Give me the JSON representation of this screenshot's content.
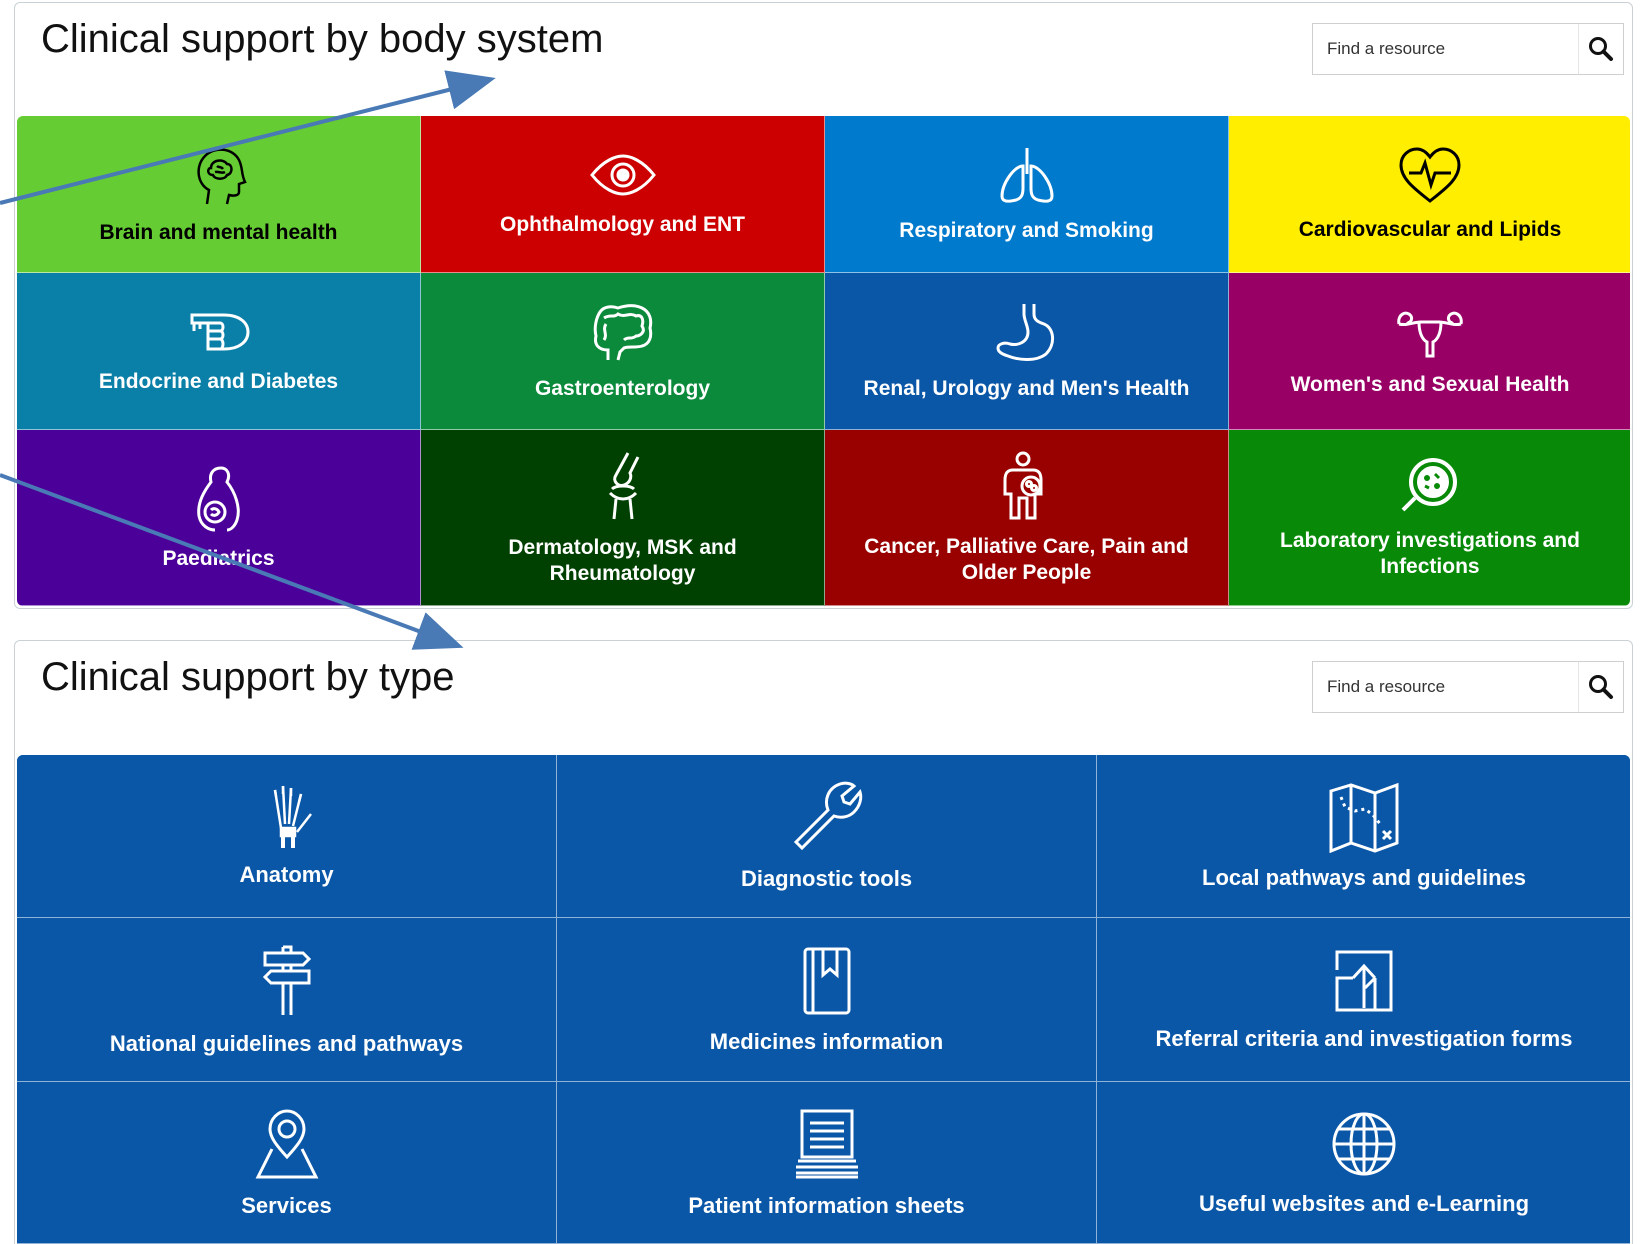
{
  "body_system": {
    "title": "Clinical support by body system",
    "search_placeholder": "Find a resource",
    "tiles": [
      {
        "label": "Brain and mental health",
        "icon": "head-brain-icon",
        "color": "#66cc33",
        "text_color": "#000000"
      },
      {
        "label": "Ophthalmology and ENT",
        "icon": "eye-icon",
        "color": "#cc0000",
        "text_color": "#ffffff"
      },
      {
        "label": "Respiratory and Smoking",
        "icon": "lungs-icon",
        "color": "#007acc",
        "text_color": "#ffffff"
      },
      {
        "label": "Cardiovascular and Lipids",
        "icon": "heart-pulse-icon",
        "color": "#ffee00",
        "text_color": "#000000"
      },
      {
        "label": "Endocrine and Diabetes",
        "icon": "finger-prick-icon",
        "color": "#0a7fa8",
        "text_color": "#ffffff"
      },
      {
        "label": "Gastroenterology",
        "icon": "intestine-icon",
        "color": "#0b8a3c",
        "text_color": "#ffffff"
      },
      {
        "label": "Renal, Urology and Men's Health",
        "icon": "stomach-icon",
        "color": "#0a56a7",
        "text_color": "#ffffff"
      },
      {
        "label": "Women's and Sexual Health",
        "icon": "uterus-icon",
        "color": "#990066",
        "text_color": "#ffffff"
      },
      {
        "label": "Paediatrics",
        "icon": "pregnancy-icon",
        "color": "#4b0099",
        "text_color": "#ffffff"
      },
      {
        "label": "Dermatology, MSK and Rheumatology",
        "icon": "knee-joint-icon",
        "color": "#004000",
        "text_color": "#ffffff"
      },
      {
        "label": "Cancer, Palliative Care, Pain and Older People",
        "icon": "person-tumor-icon",
        "color": "#990000",
        "text_color": "#ffffff"
      },
      {
        "label": "Laboratory investigations and Infections",
        "icon": "petri-dish-icon",
        "color": "#088a08",
        "text_color": "#ffffff"
      }
    ]
  },
  "by_type": {
    "title": "Clinical support by type",
    "search_placeholder": "Find a resource",
    "tile_color": "#0a56a7",
    "tiles": [
      {
        "label": "Anatomy",
        "icon": "hand-bones-icon"
      },
      {
        "label": "Diagnostic tools",
        "icon": "wrench-icon"
      },
      {
        "label": "Local pathways and guidelines",
        "icon": "map-icon"
      },
      {
        "label": "National guidelines and pathways",
        "icon": "signpost-icon"
      },
      {
        "label": "Medicines information",
        "icon": "book-icon"
      },
      {
        "label": "Referral criteria and investigation forms",
        "icon": "upload-arrow-icon"
      },
      {
        "label": "Services",
        "icon": "location-pin-icon"
      },
      {
        "label": "Patient information sheets",
        "icon": "document-stack-icon"
      },
      {
        "label": "Useful websites and e-Learning",
        "icon": "globe-icon"
      }
    ]
  },
  "annotation_color": "#4a7ab5"
}
